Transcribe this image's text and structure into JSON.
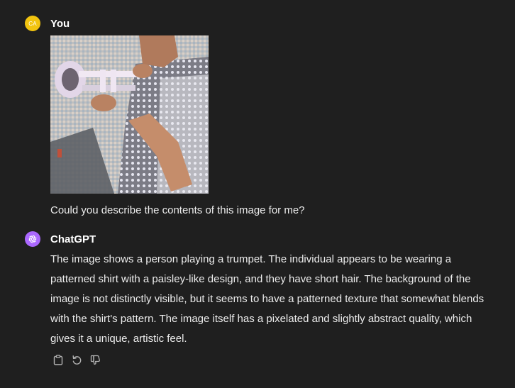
{
  "conversation": {
    "user_message": {
      "avatar_initials": "CA",
      "author": "You",
      "attachment": "trumpet-player-photo",
      "text": "Could you describe the contents of this image for me?"
    },
    "assistant_message": {
      "author": "ChatGPT",
      "avatar_icon": "chatgpt-logo-icon",
      "text": "The image shows a person playing a trumpet. The individual appears to be wearing a patterned shirt with a paisley-like design, and they have short hair. The background of the image is not distinctly visible, but it seems to have a patterned texture that somewhat blends with the shirt's pattern. The image itself has a pixelated and slightly abstract quality, which gives it a unique, artistic feel.",
      "actions": [
        {
          "name": "copy",
          "icon": "clipboard-icon"
        },
        {
          "name": "regenerate",
          "icon": "refresh-icon"
        },
        {
          "name": "dislike",
          "icon": "thumbs-down-icon"
        }
      ]
    }
  },
  "colors": {
    "background": "#1f1f1f",
    "user_avatar": "#f2c40f",
    "assistant_avatar": "#ab68ff",
    "text": "#ececec"
  }
}
